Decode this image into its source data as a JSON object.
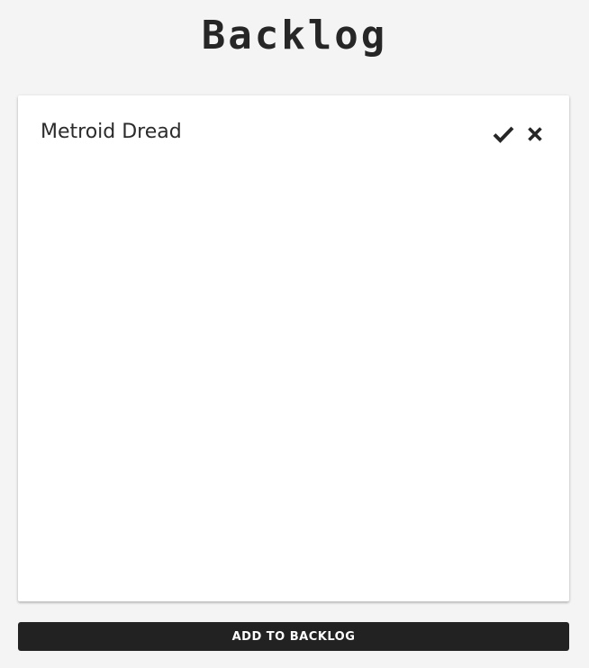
{
  "header": {
    "title": "Backlog"
  },
  "backlog": {
    "items": [
      {
        "label": "Metroid Dread",
        "actions": [
          "checkmark-icon",
          "close-icon"
        ]
      }
    ]
  },
  "footer": {
    "add_button_label": "ADD TO BACKLOG"
  },
  "colors": {
    "background": "#f4f4f4",
    "card": "#ffffff",
    "text": "#2b2b2b",
    "button_bg": "#222222",
    "button_text": "#ffffff"
  }
}
